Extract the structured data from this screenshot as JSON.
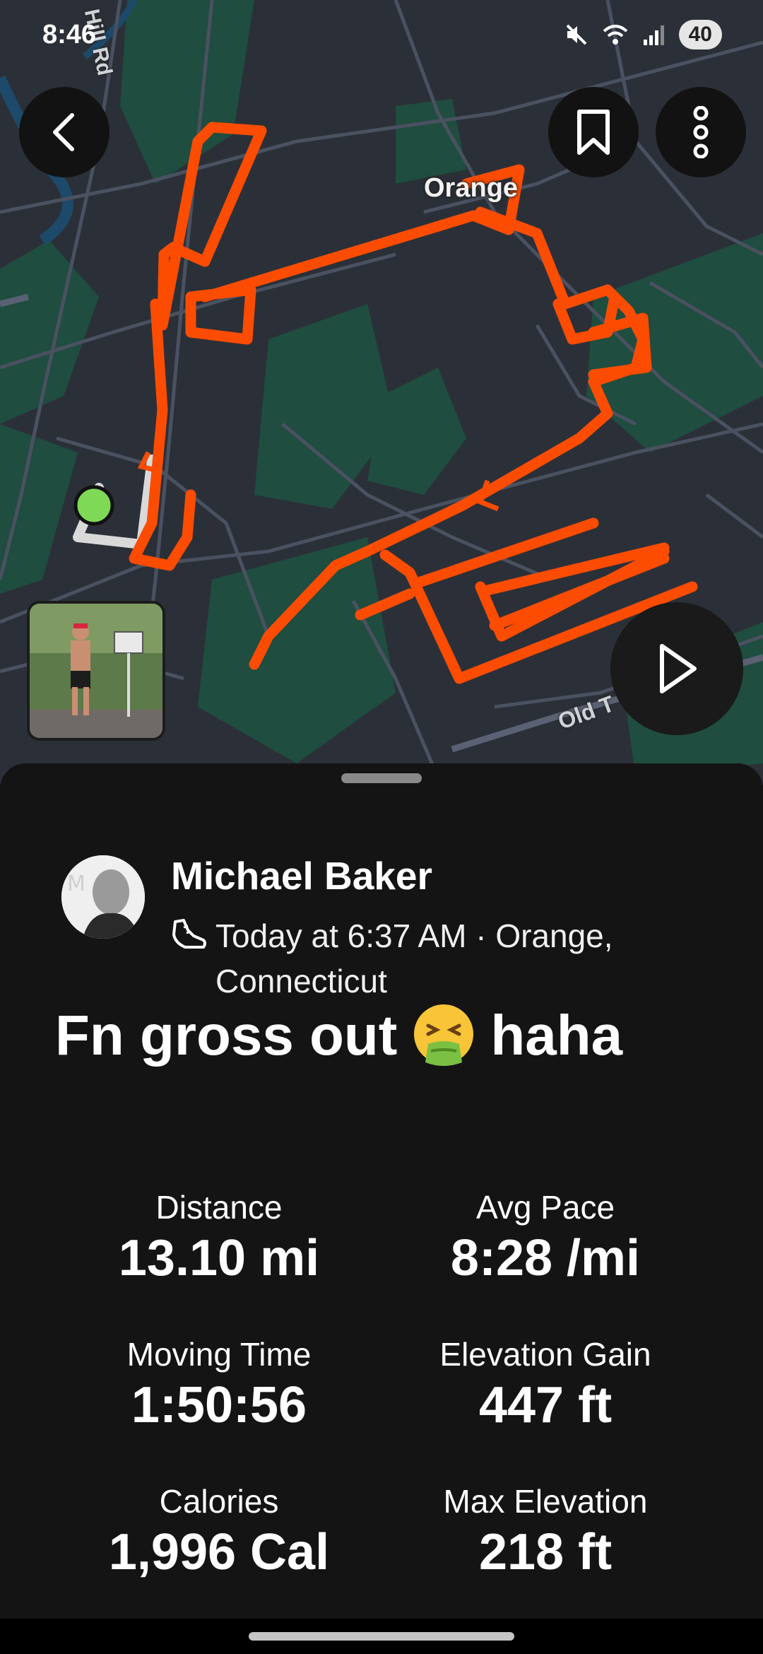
{
  "status_bar": {
    "time": "8:46",
    "battery": "40",
    "icons": [
      "mute-icon",
      "wifi-icon",
      "signal-icon"
    ]
  },
  "map": {
    "labels": {
      "town": "Orange",
      "road_top": "Hill Rd",
      "road_bottom": "Old T"
    },
    "colors": {
      "background": "#2b3038",
      "park": "#1f4d3f",
      "route": "#fc4c02",
      "start": "#7ed957"
    }
  },
  "header_buttons": {
    "back_icon": "chevron-left-icon",
    "bookmark_icon": "bookmark-icon",
    "more_icon": "more-vertical-icon",
    "play_icon": "play-icon"
  },
  "activity": {
    "athlete_name": "Michael Baker",
    "sport_icon": "shoe-icon",
    "meta": "Today at 6:37 AM · Orange, Connecticut",
    "title_before": "Fn gross out",
    "title_after": "haha"
  },
  "stats": [
    {
      "label": "Distance",
      "value": "13.10 mi"
    },
    {
      "label": "Avg Pace",
      "value": "8:28 /mi"
    },
    {
      "label": "Moving Time",
      "value": "1:50:56"
    },
    {
      "label": "Elevation Gain",
      "value": "447 ft"
    },
    {
      "label": "Calories",
      "value": "1,996 Cal"
    },
    {
      "label": "Max Elevation",
      "value": "218 ft"
    }
  ]
}
